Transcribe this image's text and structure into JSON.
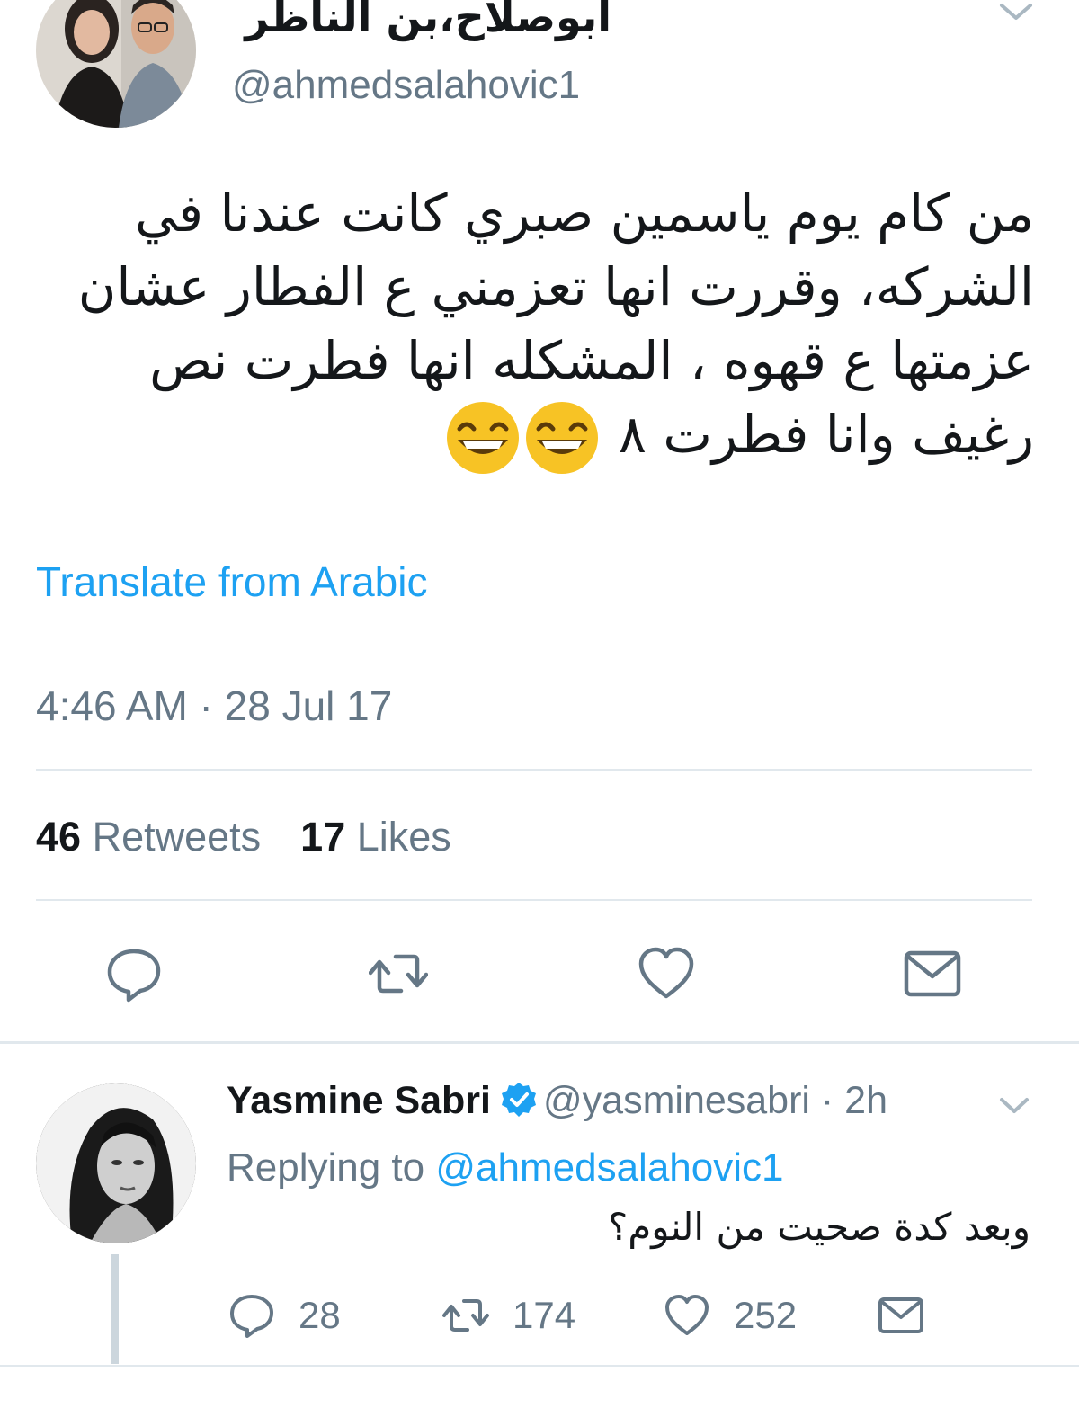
{
  "tweet": {
    "display_name": "ابوصلاح،بن الناظر",
    "handle": "@ahmedsalahovic1",
    "text": "من كام يوم ياسمين صبري كانت عندنا في الشركه، وقررت انها تعزمني ع الفطار عشان عزمتها ع قهوه ، المشكله انها فطرت نص رغيف وانا فطرت ٨",
    "translate_label": "Translate from Arabic",
    "timestamp": "4:46 AM · 28 Jul 17",
    "retweets_count": "46",
    "retweets_label": "Retweets",
    "likes_count": "17",
    "likes_label": "Likes"
  },
  "reply": {
    "display_name": "Yasmine Sabri",
    "handle_time": "@yasminesabri · 2h",
    "replying_prefix": "Replying to",
    "replying_to": "@ahmedsalahovic1",
    "text": "وبعد كدة صحيت من النوم؟",
    "replies_count": "28",
    "retweets_count": "174",
    "likes_count": "252"
  },
  "colors": {
    "link": "#1da1f2",
    "secondary_text": "#657786",
    "divider": "#e1e8ed"
  },
  "icons": [
    "reply-icon",
    "retweet-icon",
    "like-icon",
    "dm-icon",
    "verified-badge-icon",
    "chevron-down-icon",
    "joy-emoji-icon"
  ]
}
